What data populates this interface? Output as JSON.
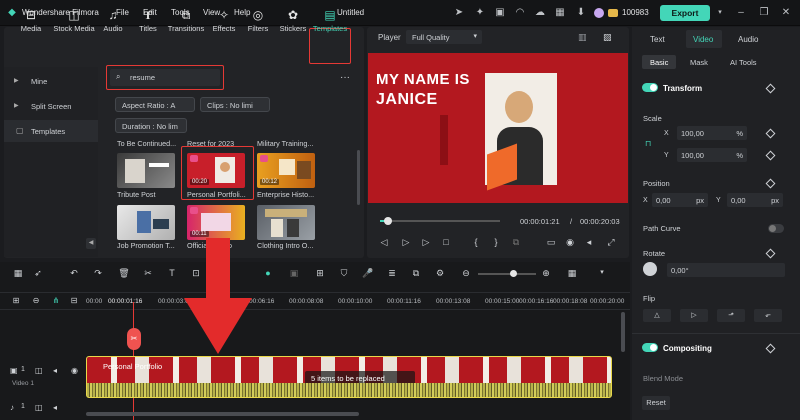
{
  "titlebar": {
    "app_name": "Wondershare Filmora",
    "menus": [
      "File",
      "Edit",
      "Tools",
      "View",
      "Help"
    ],
    "doc_title": "Untitled",
    "credits": "100983",
    "export_label": "Export"
  },
  "media_toolbar": [
    {
      "label": "Media",
      "icon": "media-icon"
    },
    {
      "label": "Stock Media",
      "icon": "stock-media-icon"
    },
    {
      "label": "Audio",
      "icon": "audio-icon"
    },
    {
      "label": "Titles",
      "icon": "titles-icon"
    },
    {
      "label": "Transitions",
      "icon": "transitions-icon"
    },
    {
      "label": "Effects",
      "icon": "effects-icon"
    },
    {
      "label": "Filters",
      "icon": "filters-icon"
    },
    {
      "label": "Stickers",
      "icon": "stickers-icon"
    },
    {
      "label": "Templates",
      "icon": "templates-icon"
    }
  ],
  "sidebar": {
    "items": [
      {
        "label": "Mine"
      },
      {
        "label": "Split Screen"
      },
      {
        "label": "Templates"
      }
    ]
  },
  "search": {
    "value": "resume"
  },
  "filters": {
    "aspect": "Aspect Ratio : A",
    "clips": "Clips : No limi",
    "duration": "Duration : No lim"
  },
  "templates": {
    "categories": [
      "To Be Continued...",
      "Reset for 2023",
      "Military Training..."
    ],
    "items": [
      {
        "label": "Tribute Post",
        "dur": ""
      },
      {
        "label": "Personal Portfoli...",
        "dur": "00:20"
      },
      {
        "label": "Enterprise Histo...",
        "dur": "00:12"
      },
      {
        "label": "Job Promotion T...",
        "dur": ""
      },
      {
        "label": "Official Promo",
        "dur": "00:11"
      },
      {
        "label": "Clothing Intro O...",
        "dur": ""
      }
    ]
  },
  "player": {
    "label": "Player",
    "quality": "Full Quality",
    "current_time": "00:00:01:21",
    "total_time": "00:00:20:03",
    "progress": 0.07,
    "preview_line1": "MY NAME IS",
    "preview_line2": "JANICE"
  },
  "props": {
    "tabs": [
      "Text",
      "Video",
      "Audio"
    ],
    "subtabs": [
      "Basic",
      "Mask",
      "AI Tools"
    ],
    "transform": "Transform",
    "scale": "Scale",
    "scale_x": "100,00",
    "scale_y": "100,00",
    "pct": "%",
    "x": "X",
    "y": "Y",
    "position": "Position",
    "pos_x": "0,00",
    "pos_y": "0,00",
    "px": "px",
    "path_curve": "Path Curve",
    "rotate": "Rotate",
    "rotate_val": "0,00°",
    "flip": "Flip",
    "compositing": "Compositing",
    "blend_mode": "Blend Mode",
    "reset": "Reset"
  },
  "timeline": {
    "ruler": [
      "00:00",
      "00:00:03:08",
      "00:00:06:16",
      "00:00:08:08",
      "00:00:10:00",
      "00:00:11:16",
      "00:00:13:08",
      "00:00:15:00",
      "00:00:16:16",
      "00:00:18:08",
      "00:00:20:00"
    ],
    "playhead_time": "00:00:01:16",
    "clip_title": "Personal Portfolio",
    "replace_msg": "5 items to be replaced",
    "track_label": "Video 1",
    "track_num": "1"
  },
  "colors": {
    "accent": "#43d6b8",
    "highlight": "#e53935",
    "preview_bg": "#b3181f"
  }
}
